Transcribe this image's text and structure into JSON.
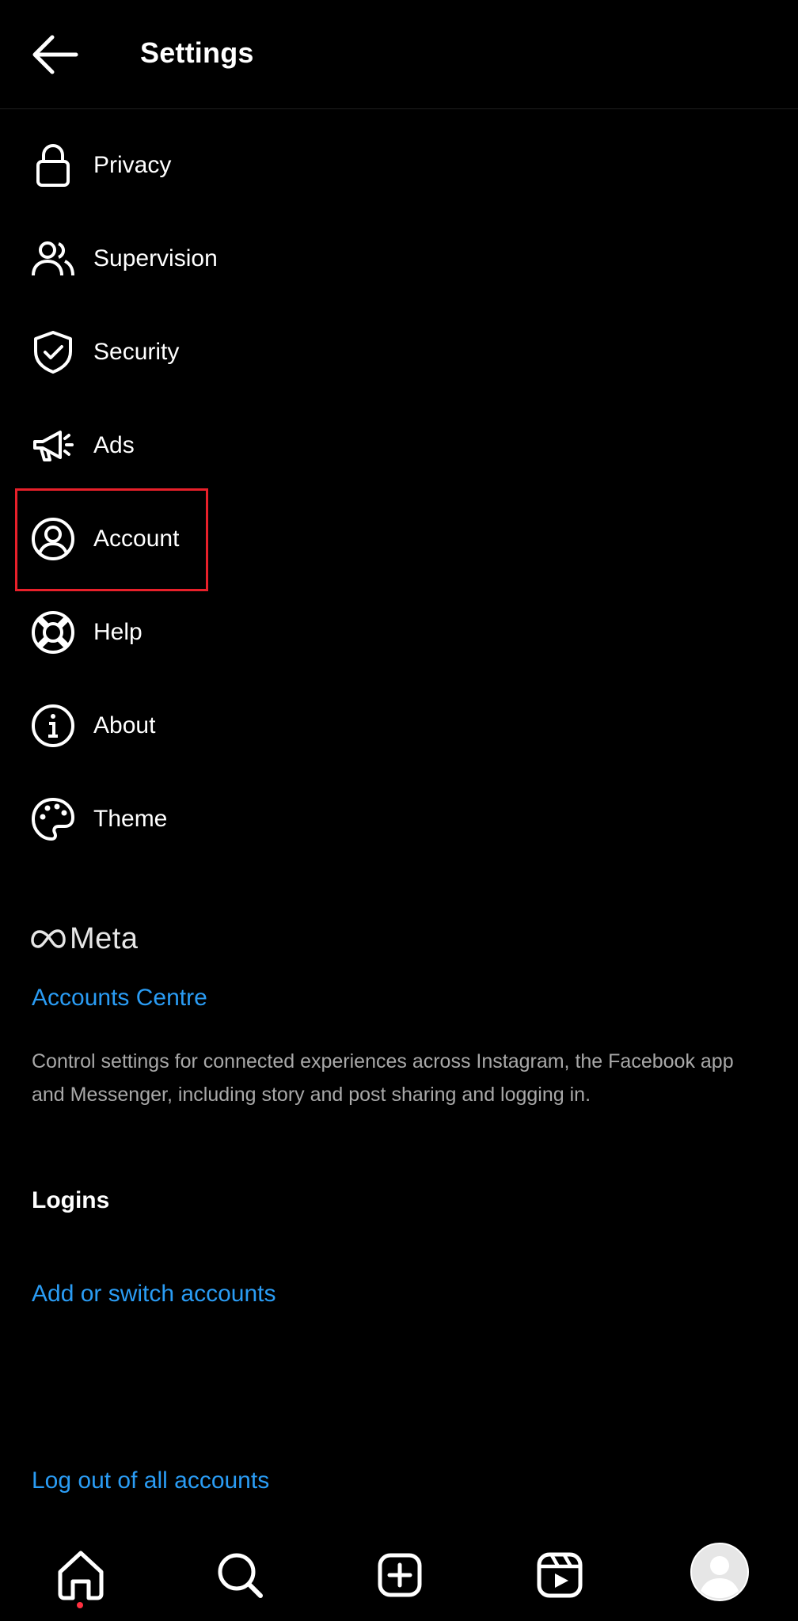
{
  "header": {
    "title": "Settings",
    "back_icon": "arrow-left-icon"
  },
  "menu": {
    "items": [
      {
        "label": "Privacy",
        "icon": "lock-icon"
      },
      {
        "label": "Supervision",
        "icon": "people-icon"
      },
      {
        "label": "Security",
        "icon": "shield-check-icon"
      },
      {
        "label": "Ads",
        "icon": "megaphone-icon"
      },
      {
        "label": "Account",
        "icon": "account-icon"
      },
      {
        "label": "Help",
        "icon": "lifebuoy-icon"
      },
      {
        "label": "About",
        "icon": "info-icon"
      },
      {
        "label": "Theme",
        "icon": "palette-icon"
      }
    ],
    "highlighted_item": "Account",
    "highlight_color": "#e8202a"
  },
  "meta": {
    "wordmark": "Meta",
    "accounts_centre": "Accounts Centre",
    "description": "Control settings for connected experiences across Instagram, the Facebook app and Messenger, including story and post sharing and logging in."
  },
  "logins": {
    "title": "Logins",
    "add_switch": "Add or switch accounts",
    "logout_all": "Log out of all accounts"
  },
  "bottom_nav": {
    "items": [
      "home-icon",
      "search-icon",
      "create-icon",
      "reels-icon",
      "profile-avatar"
    ],
    "notification_dot_color": "#ff3040"
  },
  "colors": {
    "background": "#000000",
    "text": "#ffffff",
    "link": "#2a9cf4",
    "secondary_text": "#a8a8a8"
  }
}
